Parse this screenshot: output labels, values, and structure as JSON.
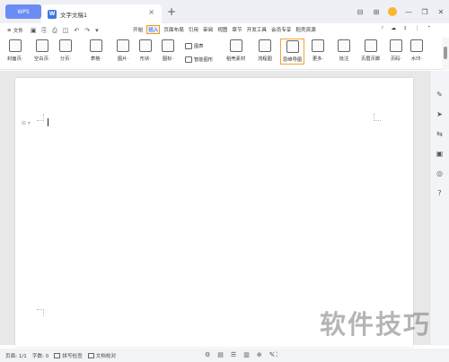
{
  "titlebar": {
    "app_tab": "WPS",
    "doc_tab_icon": "W",
    "doc_title": "文字文稿1",
    "close_glyph": "×",
    "new_tab_glyph": "+",
    "window_controls": [
      "⊟",
      "⊞"
    ]
  },
  "menubar": {
    "file_label": "文件",
    "tabs": [
      "开始",
      "插入",
      "页面布局",
      "引用",
      "审阅",
      "视图",
      "章节",
      "开发工具",
      "会员专享",
      "稻壳资源"
    ],
    "active_tab": "插入"
  },
  "ribbon": {
    "buttons": [
      {
        "label": "封面页·"
      },
      {
        "label": "空白页·"
      },
      {
        "label": "分页·"
      },
      {
        "label": "表格·"
      },
      {
        "label": "图片·"
      },
      {
        "label": "形状·"
      },
      {
        "label": "图标·"
      },
      {
        "label": "稻壳素材"
      },
      {
        "label": "流程图"
      },
      {
        "label": "思维导图"
      },
      {
        "label": "更多·"
      },
      {
        "label": "批注"
      },
      {
        "label": "页眉页脚"
      },
      {
        "label": "页码·"
      },
      {
        "label": "水印·"
      }
    ],
    "small_buttons": [
      {
        "label": "图表"
      },
      {
        "label": "智能图形"
      }
    ],
    "highlighted": "思维导图"
  },
  "statusbar": {
    "page": "页面: 1/1",
    "words": "字数: 0",
    "spellcheck": "拼写检查",
    "proofread": "文档校对"
  },
  "watermark": "软件技巧",
  "colors": {
    "accent": "#1a57d8",
    "highlight": "#f39c12",
    "app_tab": "#6b8cf5"
  }
}
